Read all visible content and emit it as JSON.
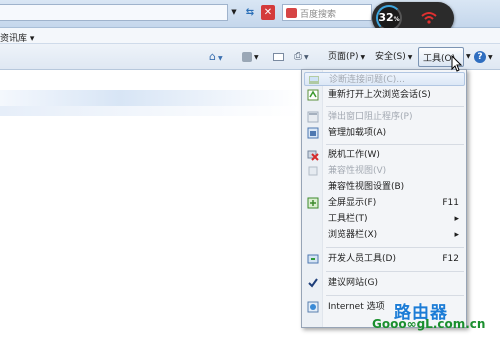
{
  "toolbar": {
    "refresh_icon": "refresh-arrows-icon",
    "stop_icon": "stop-x-icon",
    "search_placeholder": "百度搜索"
  },
  "overlay": {
    "network_percent": "32",
    "percent_sign": "%",
    "wifi_icon": "wifi-warning-icon"
  },
  "favorites": {
    "partial_label": "资讯库"
  },
  "commandbar": {
    "home_icon": "home-icon",
    "feeds_icon": "rss-feeds-icon",
    "mail_icon": "mail-icon",
    "print_icon": "print-icon",
    "page_label": "页面(P)",
    "safety_label": "安全(S)",
    "tools_label": "工具(O)",
    "help_icon": "help-icon"
  },
  "tools_menu": {
    "items": [
      {
        "label": "诊断连接问题(C)...",
        "shortcut": "",
        "disabled": true,
        "icon": "diagnose-icon"
      },
      {
        "label": "重新打开上次浏览会话(S)",
        "shortcut": "",
        "disabled": false,
        "icon": "reopen-session-icon"
      },
      {
        "label": "弹出窗口阻止程序(P)",
        "shortcut": "",
        "disabled": true,
        "icon": "popup-blocker-icon"
      },
      {
        "label": "管理加载项(A)",
        "shortcut": "",
        "disabled": false,
        "icon": "manage-addons-icon"
      },
      {
        "label": "脱机工作(W)",
        "shortcut": "",
        "disabled": false,
        "icon": "offline-icon"
      },
      {
        "label": "兼容性视图(V)",
        "shortcut": "",
        "disabled": true,
        "icon": "compat-view-icon"
      },
      {
        "label": "兼容性视图设置(B)",
        "shortcut": "",
        "disabled": false,
        "icon": ""
      },
      {
        "label": "全屏显示(F)",
        "shortcut": "F11",
        "disabled": false,
        "icon": "fullscreen-icon"
      },
      {
        "label": "工具栏(T)",
        "shortcut": "▸",
        "disabled": false,
        "icon": ""
      },
      {
        "label": "浏览器栏(X)",
        "shortcut": "▸",
        "disabled": false,
        "icon": ""
      },
      {
        "label": "开发人员工具(D)",
        "shortcut": "F12",
        "disabled": false,
        "icon": "dev-tools-icon"
      },
      {
        "label": "建议网站(G)",
        "shortcut": "",
        "disabled": false,
        "icon": "check-icon"
      },
      {
        "label": "Internet 选项",
        "shortcut": "",
        "disabled": false,
        "icon": "internet-options-icon"
      }
    ]
  },
  "watermark": {
    "cn": "路由器",
    "en": "Gooo∞gL.com.cn"
  },
  "colors": {
    "accent": "#3ea6de",
    "menu_bg": "#f3f5f8",
    "watermark_blue": "#1c7cd6",
    "watermark_green": "#1a8f2e"
  }
}
